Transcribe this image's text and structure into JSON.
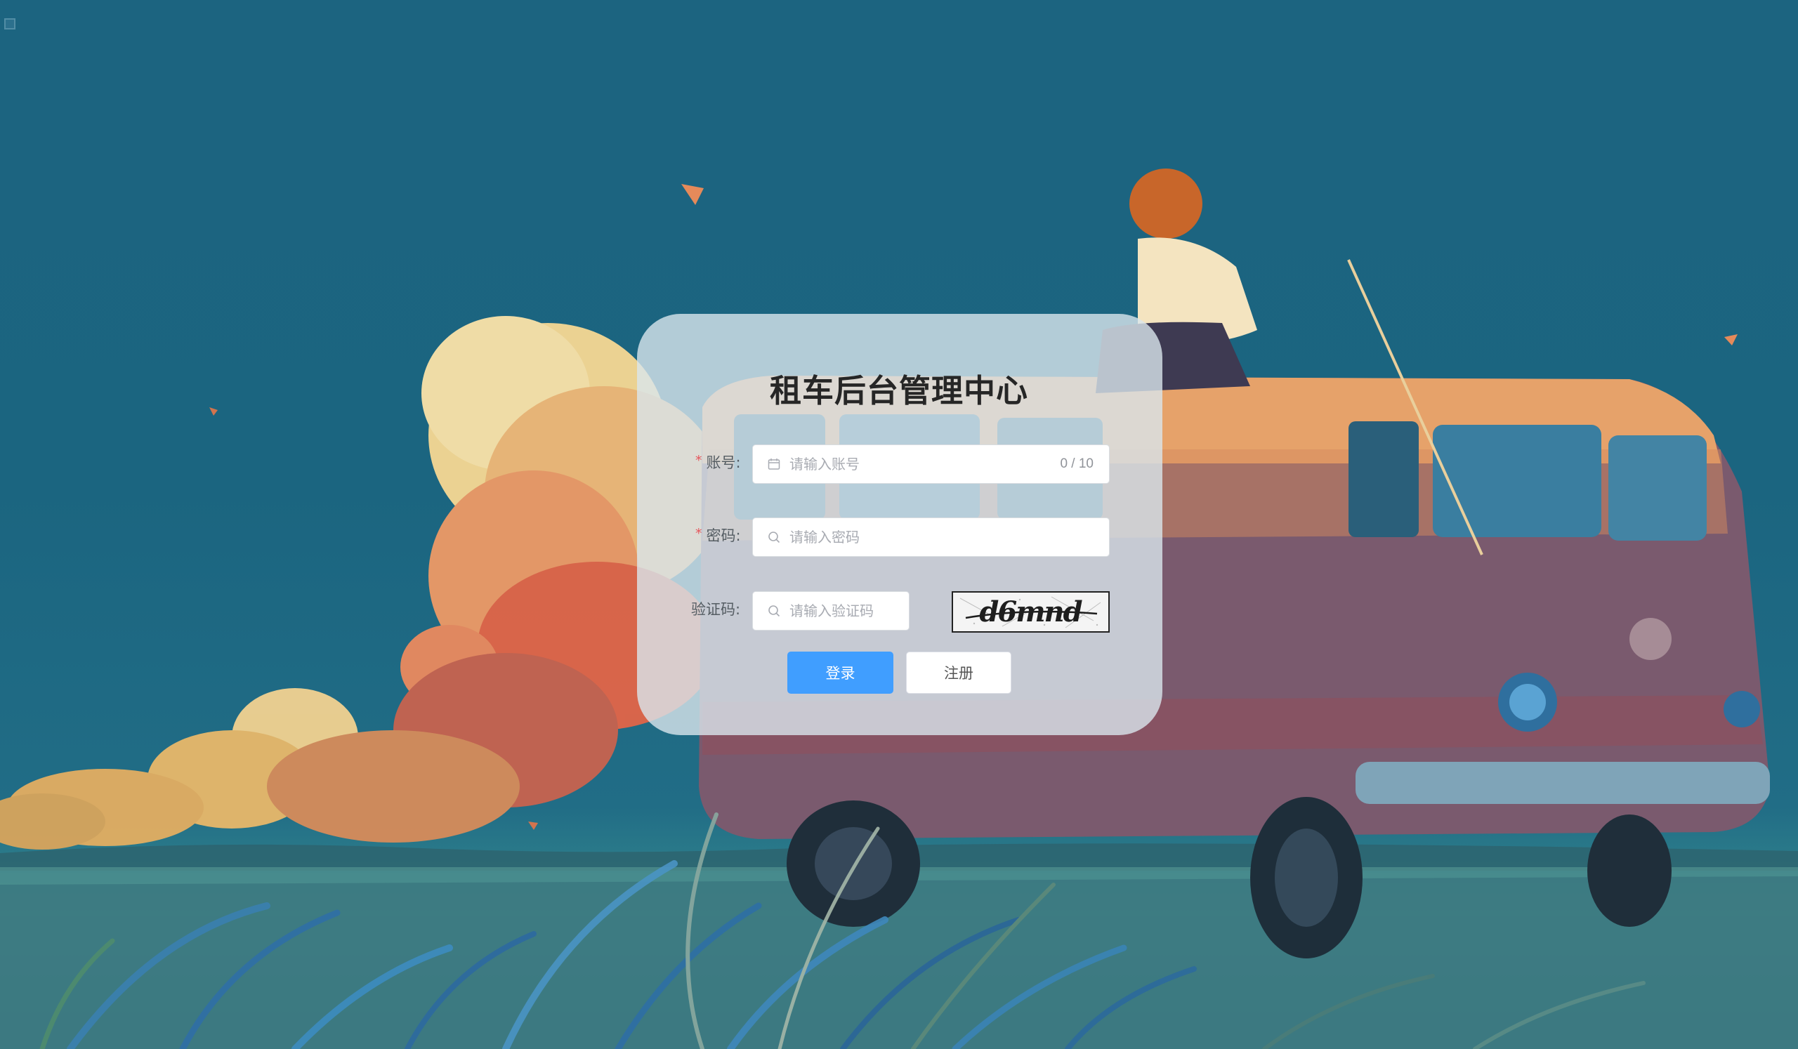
{
  "login": {
    "title": "租车后台管理中心",
    "account": {
      "label": "账号:",
      "required_mark": "*",
      "placeholder": "请输入账号",
      "value": "",
      "counter": "0 / 10"
    },
    "password": {
      "label": "密码:",
      "required_mark": "*",
      "placeholder": "请输入密码",
      "value": ""
    },
    "captcha": {
      "label": "验证码:",
      "placeholder": "请输入验证码",
      "value": "",
      "image_text": "d6mnd"
    },
    "buttons": {
      "login": "登录",
      "register": "注册"
    }
  },
  "colors": {
    "primary": "#409eff",
    "required": "#e5565c",
    "card_bg": "#dae6ec"
  }
}
